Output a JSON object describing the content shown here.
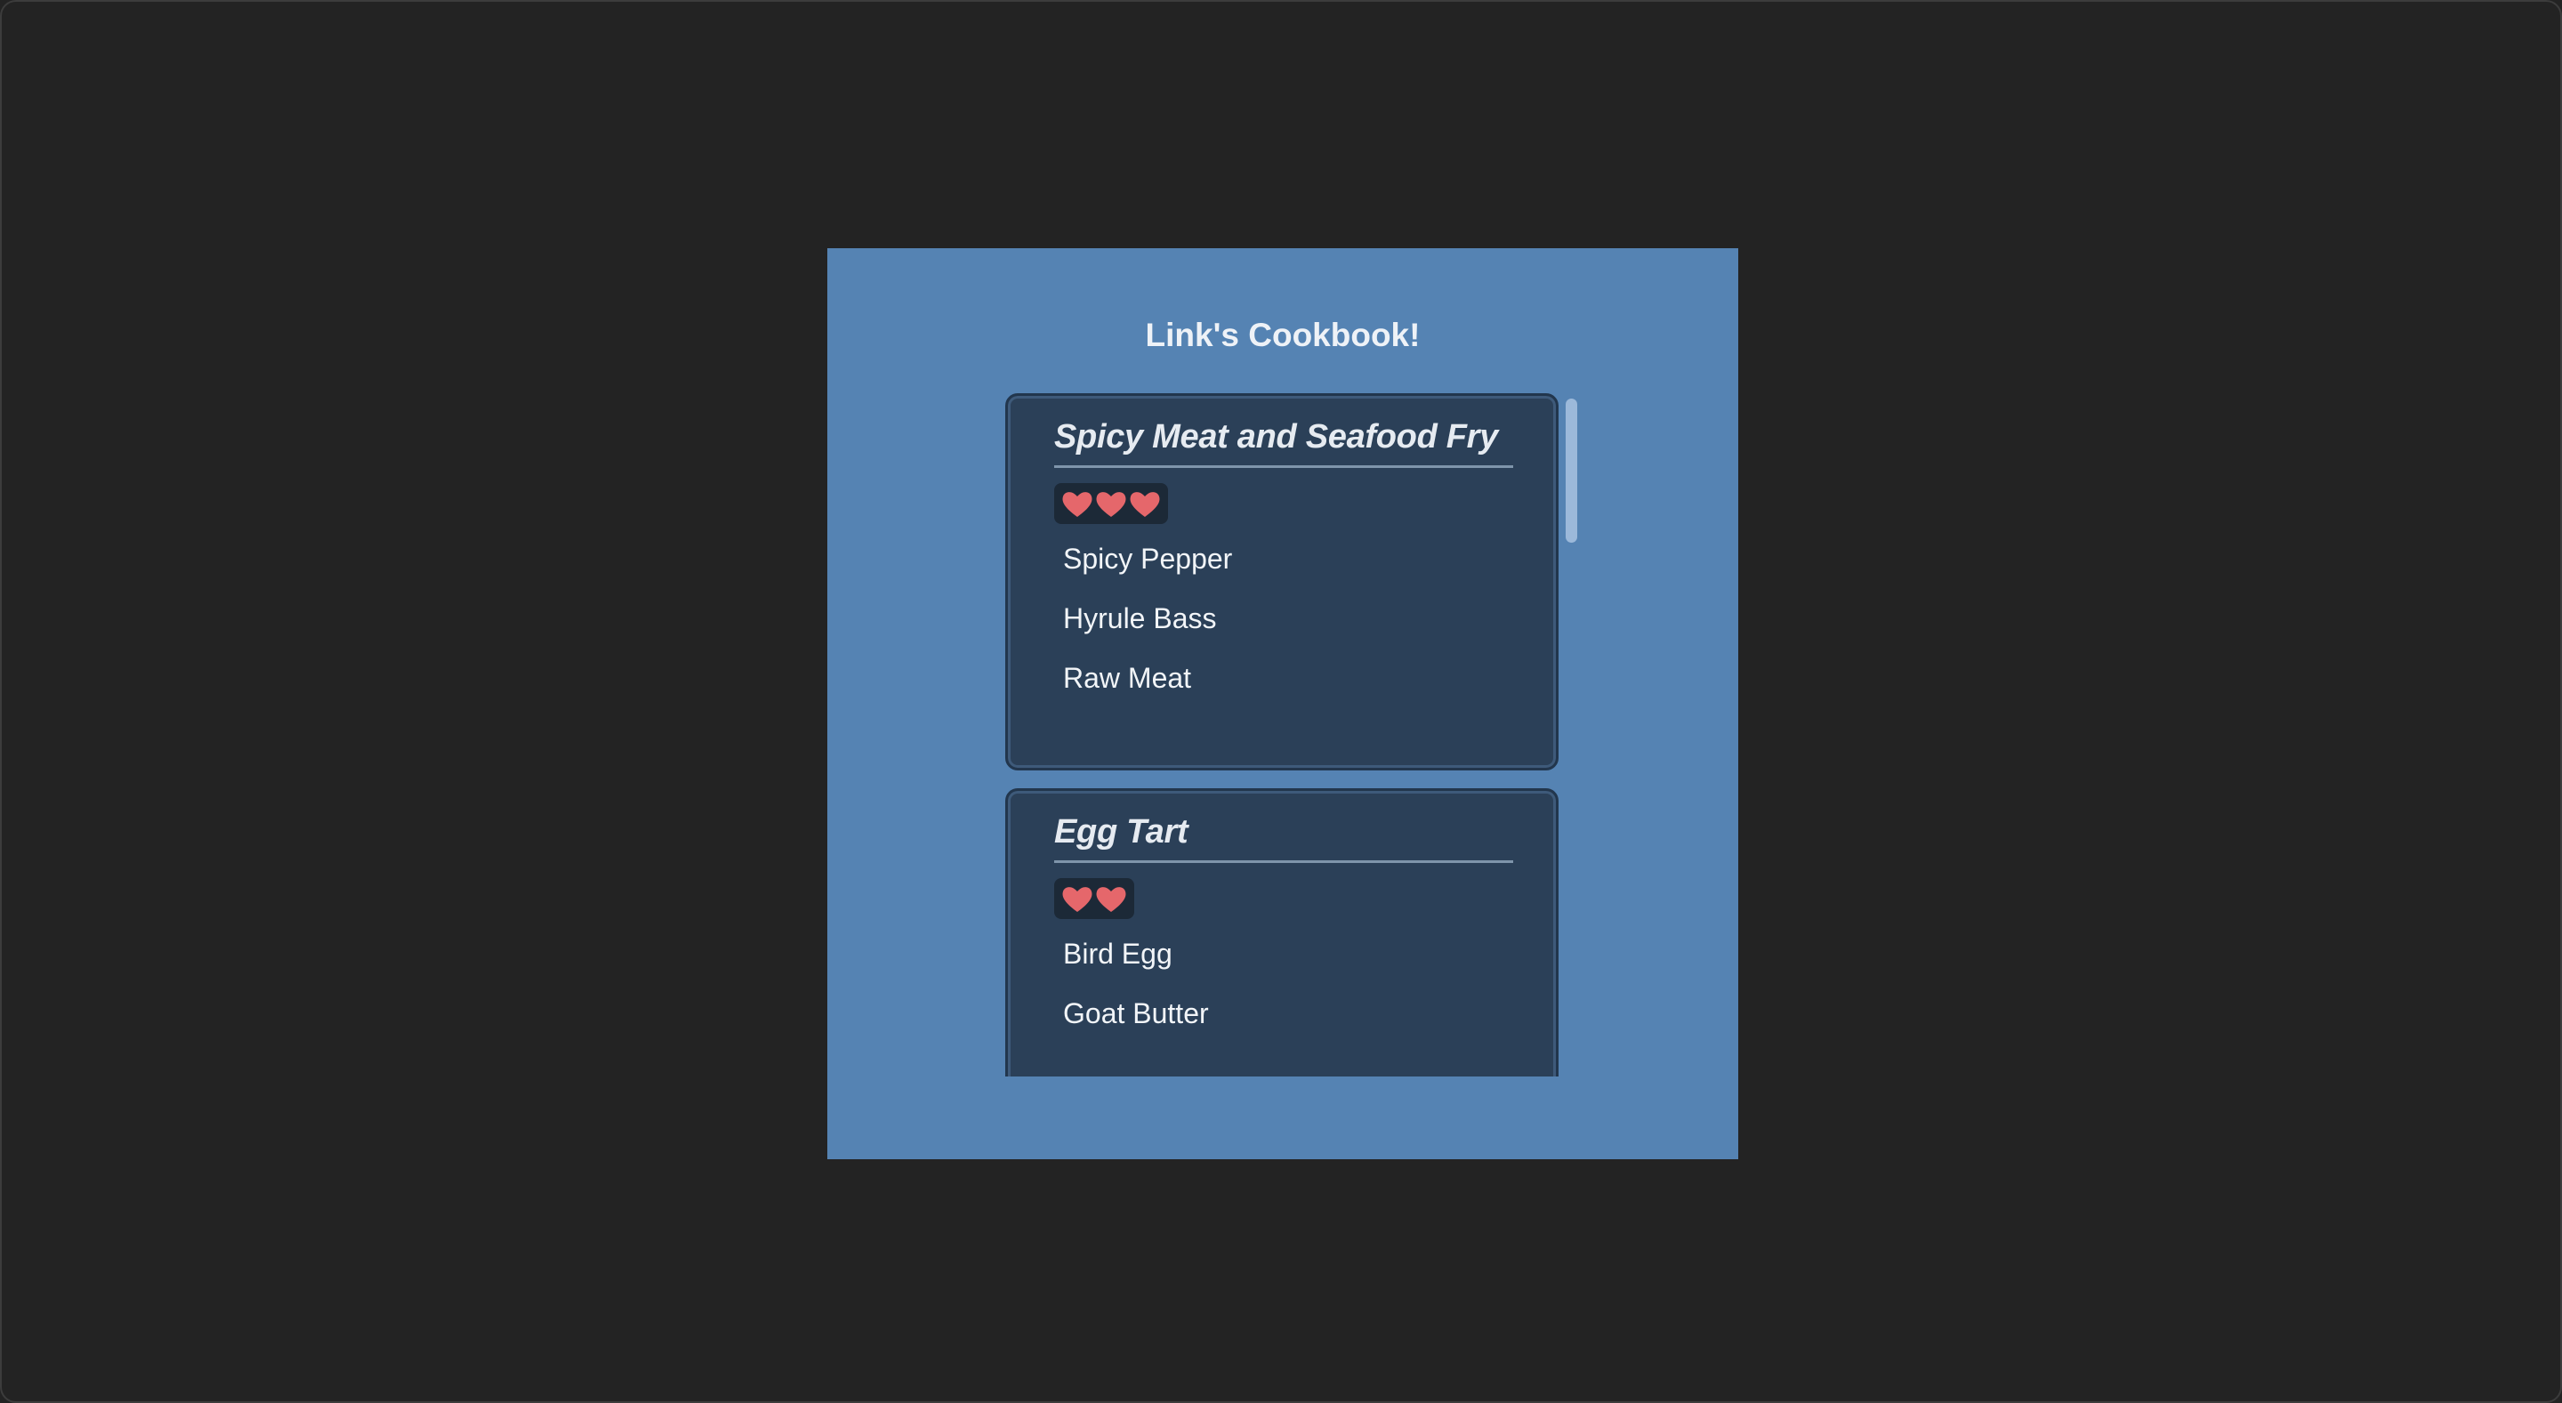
{
  "app": {
    "title": "Link's Cookbook!"
  },
  "recipes": [
    {
      "name": "Spicy Meat and Seafood Fry",
      "hearts": 3,
      "ingredients": [
        "Spicy Pepper",
        "Hyrule Bass",
        "Raw Meat"
      ]
    },
    {
      "name": "Egg Tart",
      "hearts": 2,
      "ingredients": [
        "Bird Egg",
        "Goat Butter"
      ]
    }
  ],
  "colors": {
    "background": "#232323",
    "panel": "#5583b3",
    "card": "#2b4058",
    "heart": "#e5676b",
    "badge": "#1c2937"
  },
  "icons": {
    "heart": "heart-icon"
  }
}
